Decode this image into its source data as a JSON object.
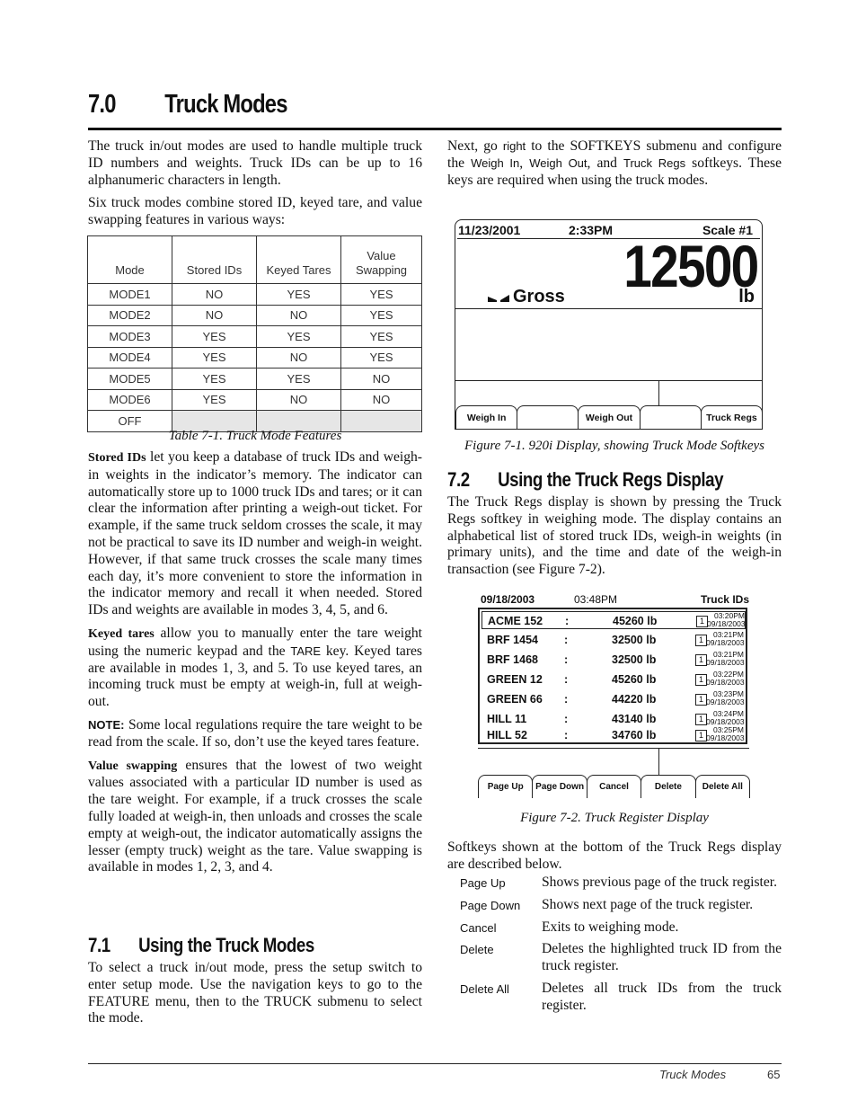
{
  "heading": {
    "number": "7.0",
    "title": "Truck Modes"
  },
  "left": {
    "intro_p1": "The truck in/out modes are used to handle multiple truck ID numbers and weights. Truck IDs can be up to 16 alphanumeric characters in length.",
    "intro_p2": "Six truck modes combine stored ID, keyed tare, and value swapping features in various ways:",
    "table": {
      "headers": [
        "Mode",
        "Stored IDs",
        "Keyed Tares",
        "Value Swapping"
      ],
      "rows": [
        [
          "MODE1",
          "NO",
          "YES",
          "YES"
        ],
        [
          "MODE2",
          "NO",
          "NO",
          "YES"
        ],
        [
          "MODE3",
          "YES",
          "YES",
          "YES"
        ],
        [
          "MODE4",
          "YES",
          "NO",
          "YES"
        ],
        [
          "MODE5",
          "YES",
          "YES",
          "NO"
        ],
        [
          "MODE6",
          "YES",
          "NO",
          "NO"
        ],
        [
          "OFF",
          "",
          "",
          ""
        ]
      ],
      "caption": "Table 7-1. Truck Mode Features"
    },
    "stored_ids": {
      "term": "Stored IDs",
      "text": " let you keep a database of truck IDs and weigh-in weights in the indicator’s memory. The indicator can automatically store up to 1000 truck IDs and tares; or it can clear the information after printing a weigh-out ticket. For example, if the same truck seldom crosses the scale, it may not be practical to save its ID number and weigh-in weight. However, if that same truck crosses the scale many times each day, it’s more convenient to store the information in the indicator memory and recall it when needed. Stored IDs and weights are available in modes 3, 4, 5, and 6."
    },
    "keyed_tares": {
      "term": "Keyed tares",
      "text_a": " allow you to manually enter the tare weight using the numeric keypad and the ",
      "key": "TARE",
      "text_b": " key. Keyed tares are available in modes 1, 3, and 5. To use keyed tares, an incoming truck must be empty at weigh-in, full at weigh-out."
    },
    "note": {
      "label": "NOTE:",
      "text": " Some local regulations require the tare weight to be read from the scale. If so, don’t use the keyed tares feature."
    },
    "value_swapping": {
      "term": "Value swapping",
      "text": " ensures that the lowest of two weight values associated with a particular ID number is used as the tare weight. For example, if a truck crosses the scale fully loaded at weigh-in, then unloads and crosses the scale empty at weigh-out, the indicator automatically assigns the lesser (empty truck) weight as the tare. Value swapping is available in modes 1, 2, 3, and 4."
    },
    "section_7_1": {
      "number": "7.1",
      "title": "Using the Truck Modes",
      "text": "To select a truck in/out mode, press the setup switch to enter setup mode. Use the navigation keys to go to the FEATURE menu, then to the TRUCK submenu to select the mode."
    }
  },
  "right": {
    "next_p": {
      "a": "Next, go ",
      "right": "right",
      "b": " to the SOFTKEYS submenu and configure the ",
      "k1": "Weigh In",
      "c": ", ",
      "k2": "Weigh Out",
      "d": ", and ",
      "k3": "Truck Regs",
      "e": " softkeys. These keys are required when using the truck modes."
    },
    "figure1": {
      "date": "11/23/2001",
      "time": "2:33PM",
      "scale": "Scale #1",
      "weight": "12500",
      "mode": "Gross",
      "unit": "lb",
      "softkeys": [
        "Weigh In",
        "",
        "Weigh Out",
        "",
        "Truck Regs"
      ],
      "caption": "Figure 7-1. 920i Display, showing Truck Mode Softkeys"
    },
    "section_7_2": {
      "number": "7.2",
      "title": "Using the Truck Regs Display",
      "text": "The Truck Regs display is shown by pressing the Truck Regs softkey in weighing mode. The display contains an alphabetical list of stored truck IDs, weigh-in weights (in primary units), and the time and date of the weigh-in transaction (see Figure 7-2)."
    },
    "figure2": {
      "date": "09/18/2003",
      "time": "03:48PM",
      "title": "Truck IDs",
      "rows": [
        {
          "id": "ACME 152",
          "weight": "45260 lb",
          "badge": "1",
          "time": "03:20PM",
          "date": "09/18/2003"
        },
        {
          "id": "BRF 1454",
          "weight": "32500 lb",
          "badge": "1",
          "time": "03:21PM",
          "date": "09/18/2003"
        },
        {
          "id": "BRF 1468",
          "weight": "32500 lb",
          "badge": "1",
          "time": "03:21PM",
          "date": "09/18/2003"
        },
        {
          "id": "GREEN 12",
          "weight": "45260 lb",
          "badge": "1",
          "time": "03:22PM",
          "date": "09/18/2003"
        },
        {
          "id": "GREEN 66",
          "weight": "44220 lb",
          "badge": "1",
          "time": "03:23PM",
          "date": "09/18/2003"
        },
        {
          "id": "HILL 11",
          "weight": "43140 lb",
          "badge": "1",
          "time": "03:24PM",
          "date": "09/18/2003"
        },
        {
          "id": "HILL 52",
          "weight": "34760 lb",
          "badge": "1",
          "time": "03:25PM",
          "date": "09/18/2003"
        }
      ],
      "separator": ":",
      "softkeys": [
        "Page Up",
        "Page Down",
        "Cancel",
        "Delete",
        "Delete All"
      ],
      "caption": "Figure 7-2. Truck Register Display"
    },
    "softkeys_intro": "Softkeys shown at the bottom of the Truck Regs display are described below.",
    "definitions": [
      {
        "term": "Page Up",
        "desc": "Shows previous page of the truck register."
      },
      {
        "term": "Page Down",
        "desc": "Shows next page of the truck register."
      },
      {
        "term": "Cancel",
        "desc": "Exits to weighing mode."
      },
      {
        "term": "Delete",
        "desc": "Deletes the highlighted truck ID from the truck register."
      },
      {
        "term": "Delete All",
        "desc": "Deletes all truck IDs from the truck register."
      }
    ]
  },
  "footer": {
    "section": "Truck Modes",
    "page": "65"
  }
}
